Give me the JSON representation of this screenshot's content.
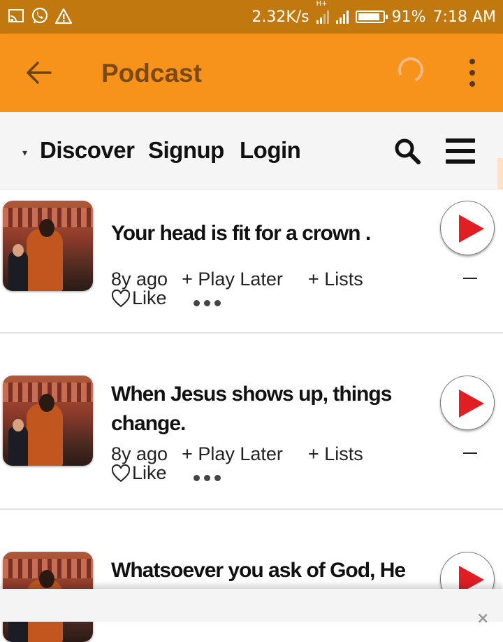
{
  "status_bar": {
    "speed": "2.32K/s",
    "network_type": "H+",
    "battery": "91%",
    "battery_level": 0.91,
    "time": "7:18 AM",
    "icons": [
      "cast-icon",
      "whatsapp-icon",
      "warning-icon"
    ]
  },
  "app_bar": {
    "title": "Podcast",
    "background": "#f7931a"
  },
  "nav": {
    "caret": "▾",
    "links": [
      "Discover",
      "Signup",
      "Login"
    ]
  },
  "episodes": [
    {
      "title": "Your head is fit for a crown .",
      "age": "8y ago",
      "play_later": "+ Play Later",
      "lists": "+ Lists",
      "like": "Like"
    },
    {
      "title": "When Jesus shows up, things change.",
      "age": "8y ago",
      "play_later": "+ Play Later",
      "lists": "+ Lists",
      "like": "Like"
    },
    {
      "title": "Whatsoever you ask of God, He",
      "age": "",
      "play_later": "",
      "lists": "",
      "like": ""
    }
  ],
  "bottom_bar": {
    "close": "×"
  },
  "colors": {
    "status_bar": "#c0780f",
    "accent": "#f7931a",
    "play_red": "#e01e24"
  }
}
